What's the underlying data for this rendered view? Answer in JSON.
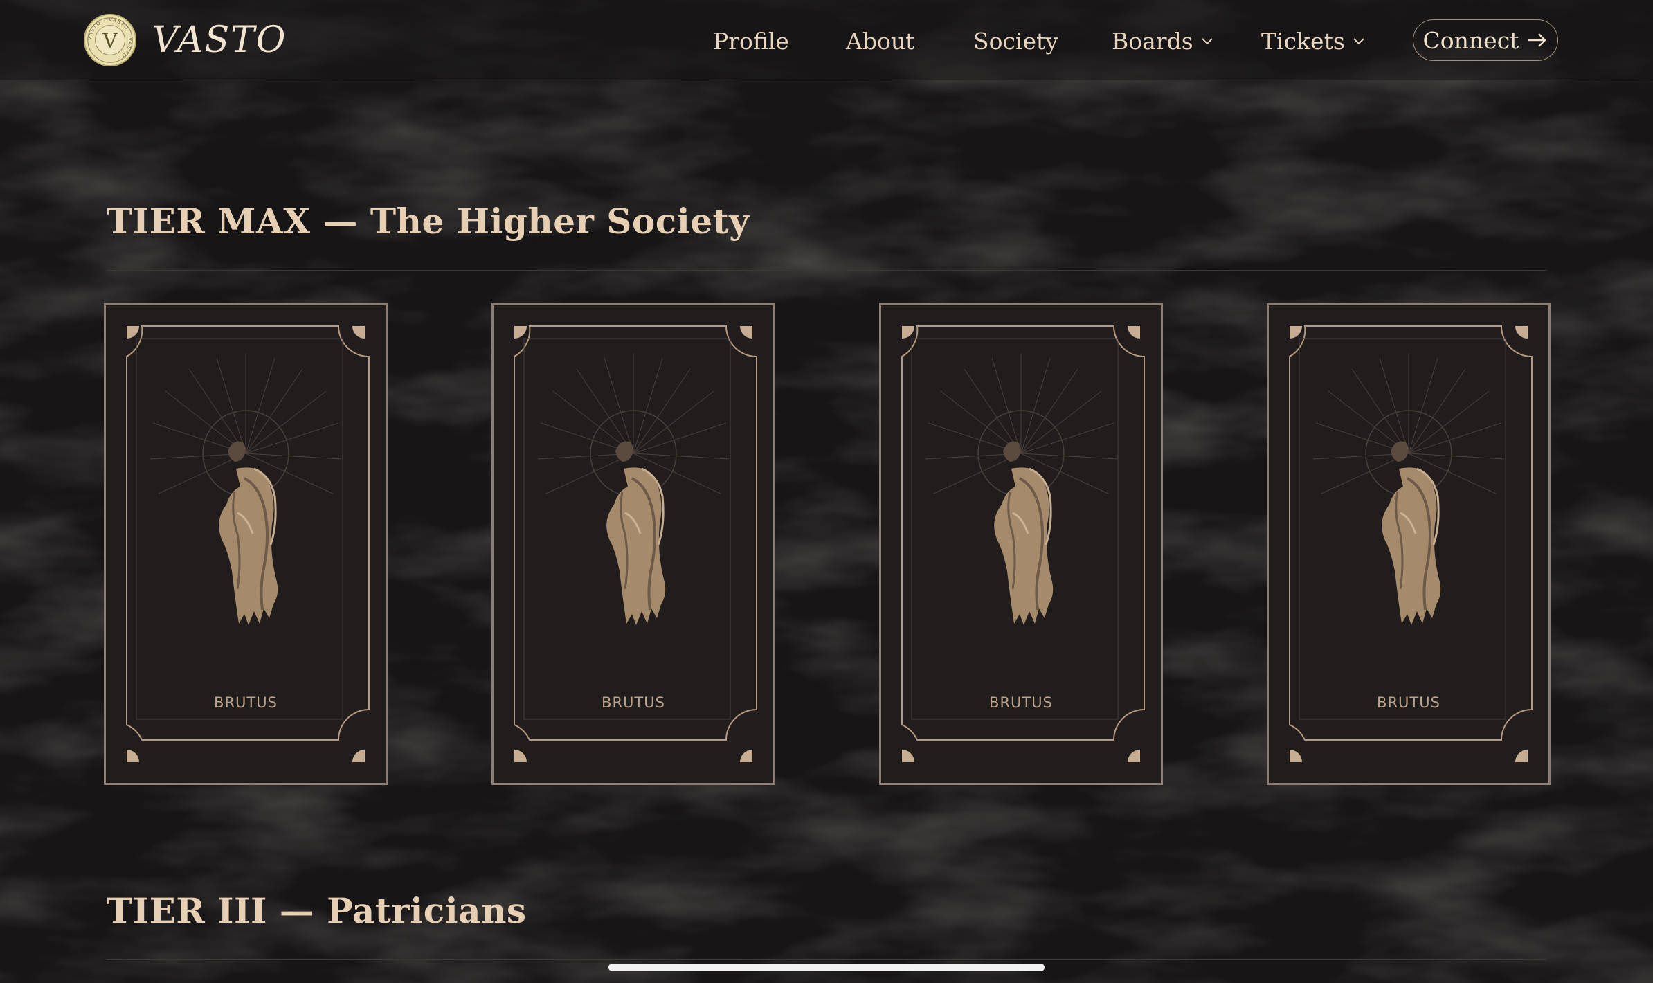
{
  "brand": {
    "name": "VASTO",
    "logo_letter": "V",
    "seal_text": "VASTO · VASTO · VASTO · "
  },
  "nav": {
    "items": [
      {
        "label": "Profile"
      },
      {
        "label": "About"
      },
      {
        "label": "Society"
      },
      {
        "label": "Boards",
        "has_dropdown": true
      },
      {
        "label": "Tickets",
        "has_dropdown": true
      }
    ],
    "connect_label": "Connect"
  },
  "sections": [
    {
      "title": "TIER MAX — The Higher Society",
      "cards": [
        {
          "label": "BRUTUS",
          "icon": "brutus-statue-icon"
        },
        {
          "label": "BRUTUS",
          "icon": "brutus-statue-icon"
        },
        {
          "label": "BRUTUS",
          "icon": "brutus-statue-icon"
        },
        {
          "label": "BRUTUS",
          "icon": "brutus-statue-icon"
        }
      ]
    },
    {
      "title": "TIER III — Patricians"
    }
  ],
  "colors": {
    "background": "#171516",
    "accent": "#e7cfb3",
    "card_border": "#8c7d70",
    "card_fill": "#211d1c"
  }
}
